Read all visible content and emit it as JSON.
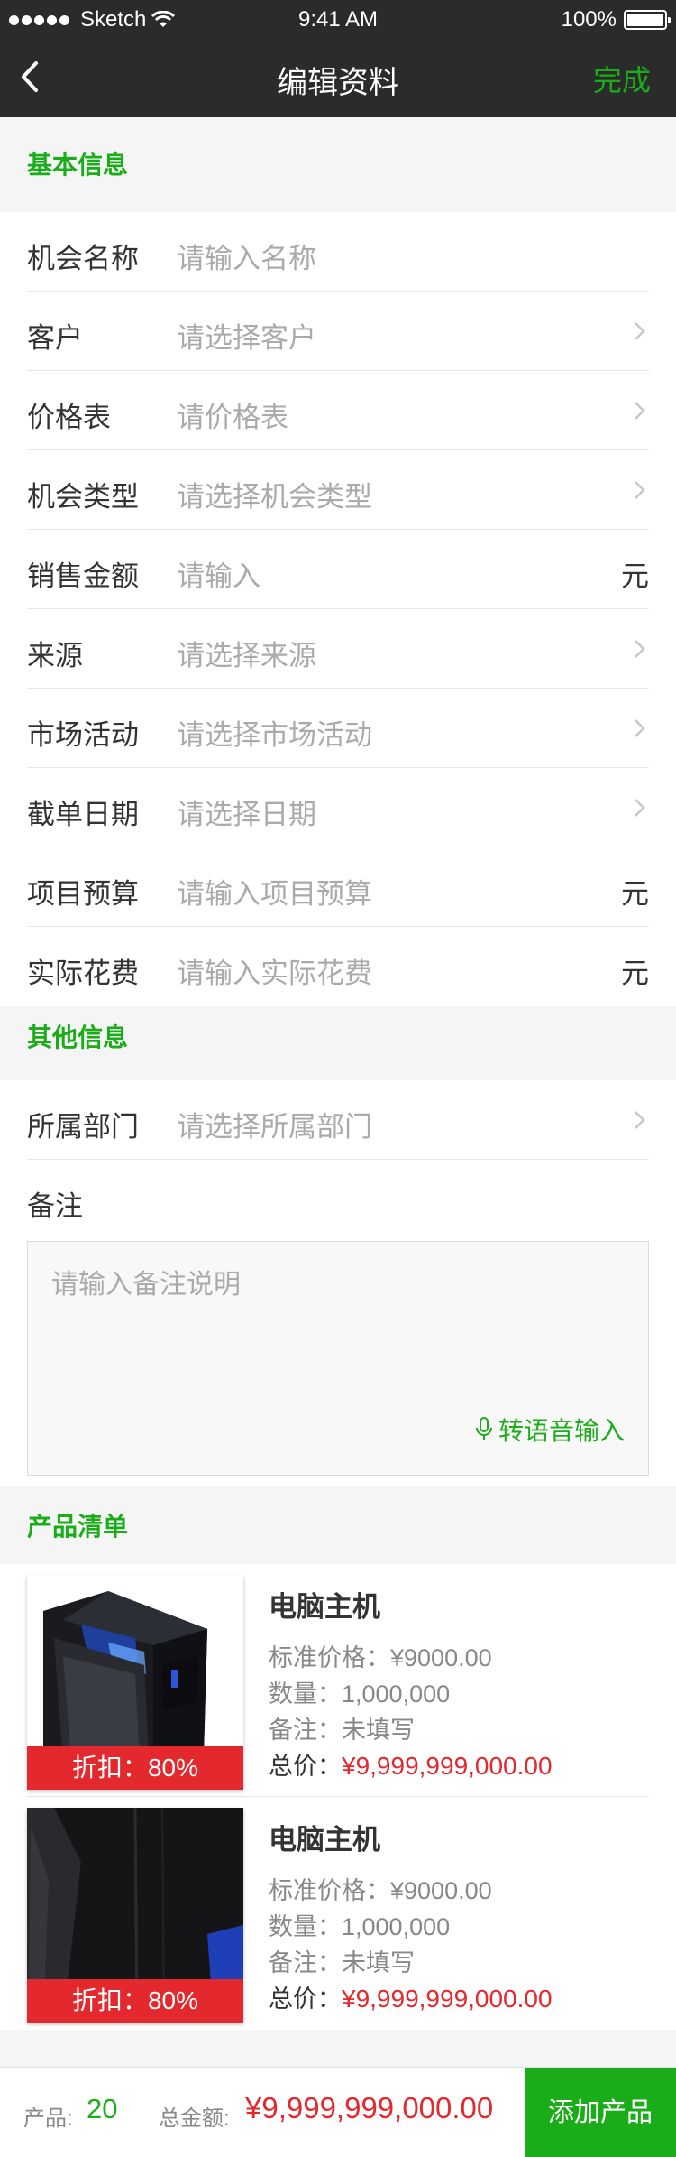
{
  "status_bar": {
    "carrier": "Sketch",
    "time": "9:41 AM",
    "battery": "100%"
  },
  "nav": {
    "title": "编辑资料",
    "done": "完成"
  },
  "basic_section": {
    "title": "基本信息",
    "rows": [
      {
        "label": "机会名称",
        "placeholder": "请输入名称"
      },
      {
        "label": "客户",
        "placeholder": "请选择客户"
      },
      {
        "label": "价格表",
        "placeholder": "请价格表"
      },
      {
        "label": "机会类型",
        "placeholder": "请选择机会类型"
      },
      {
        "label": "销售金额",
        "placeholder": "请输入",
        "unit": "元"
      },
      {
        "label": "来源",
        "placeholder": "请选择来源"
      },
      {
        "label": "市场活动",
        "placeholder": "请选择市场活动"
      },
      {
        "label": "截单日期",
        "placeholder": "请选择日期"
      },
      {
        "label": "项目预算",
        "placeholder": "请输入项目预算",
        "unit": "元"
      },
      {
        "label": "实际花费",
        "placeholder": "请输入实际花费",
        "unit": "元"
      }
    ]
  },
  "other_section": {
    "title": "其他信息",
    "department": {
      "label": "所属部门",
      "placeholder": "请选择所属部门"
    },
    "remark_label": "备注",
    "remark_placeholder": "请输入备注说明",
    "voice_input": "转语音输入"
  },
  "products_section": {
    "title": "产品清单",
    "items": [
      {
        "name": "电脑主机",
        "price": "标准价格：¥9000.00",
        "quantity": "数量：1,000,000",
        "note": "备注：未填写",
        "total_label": "总价：",
        "total_amount": "¥9,999,999,000.00",
        "discount": "折扣：80%"
      },
      {
        "name": "电脑主机",
        "price": "标准价格：¥9000.00",
        "quantity": "数量：1,000,000",
        "note": "备注：未填写",
        "total_label": "总价：",
        "total_amount": "¥9,999,999,000.00",
        "discount": "折扣：80%"
      }
    ]
  },
  "bottom_bar": {
    "count_label": "产品:",
    "count_value": "20",
    "sum_label": "总金额:",
    "sum_value": "¥9,999,999,000.00",
    "add_button": "添加产品"
  },
  "colors": {
    "accent": "#1aad19",
    "price": "#e3292e",
    "nav_bg": "#2b2b2b"
  }
}
